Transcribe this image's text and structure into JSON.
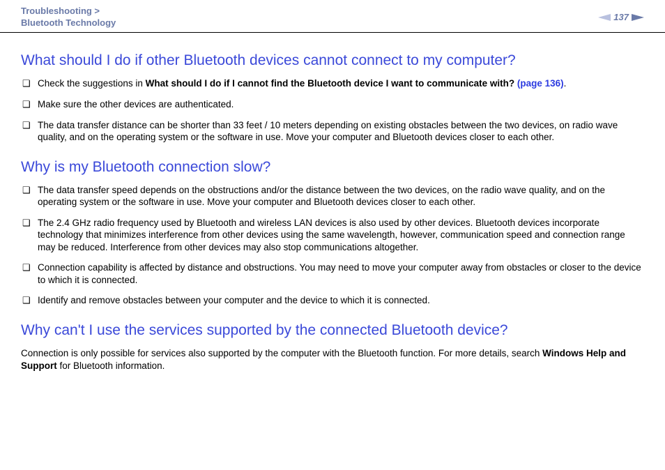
{
  "header": {
    "breadcrumb_line1": "Troubleshooting >",
    "breadcrumb_line2": "Bluetooth Technology",
    "page_number": "137"
  },
  "sections": [
    {
      "heading": "What should I do if other Bluetooth devices cannot connect to my computer?",
      "items": [
        {
          "prefix": "Check the suggestions in ",
          "bold": "What should I do if I cannot find the Bluetooth device I want to communicate with? ",
          "link": "(page 136)",
          "suffix": "."
        },
        {
          "text": "Make sure the other devices are authenticated."
        },
        {
          "text": "The data transfer distance can be shorter than 33 feet / 10 meters depending on existing obstacles between the two devices, on radio wave quality, and on the operating system or the software in use. Move your computer and Bluetooth devices closer to each other."
        }
      ]
    },
    {
      "heading": "Why is my Bluetooth connection slow?",
      "items": [
        {
          "text": "The data transfer speed depends on the obstructions and/or the distance between the two devices, on the radio wave quality, and on the operating system or the software in use. Move your computer and Bluetooth devices closer to each other."
        },
        {
          "text": "The 2.4 GHz radio frequency used by Bluetooth and wireless LAN devices is also used by other devices. Bluetooth devices incorporate technology that minimizes interference from other devices using the same wavelength, however, communication speed and connection range may be reduced. Interference from other devices may also stop communications altogether."
        },
        {
          "text": "Connection capability is affected by distance and obstructions. You may need to move your computer away from obstacles or closer to the device to which it is connected."
        },
        {
          "text": "Identify and remove obstacles between your computer and the device to which it is connected."
        }
      ]
    },
    {
      "heading": "Why can't I use the services supported by the connected Bluetooth device?",
      "para_prefix": "Connection is only possible for services also supported by the computer with the Bluetooth function. For more details, search ",
      "para_bold": "Windows Help and Support",
      "para_suffix": " for Bluetooth information."
    }
  ]
}
